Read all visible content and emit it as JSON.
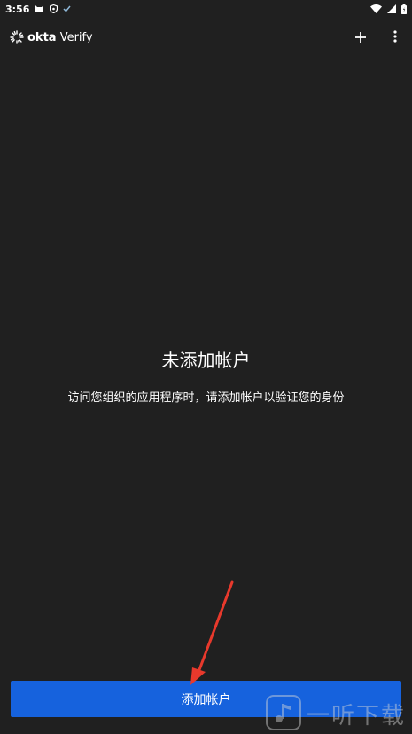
{
  "status_bar": {
    "time": "3:56",
    "left_icons": [
      "cat-icon",
      "shield-icon",
      "check-icon"
    ],
    "right_icons": [
      "wifi-icon",
      "signal-icon",
      "battery-icon"
    ]
  },
  "app_bar": {
    "logo_bold": "okta",
    "logo_rest": " Verify",
    "add_icon": "plus-icon",
    "more_icon": "more-vert-icon"
  },
  "empty_state": {
    "title": "未添加帐户",
    "description": "访问您组织的应用程序时，请添加帐户以验证您的身份"
  },
  "bottom": {
    "add_account_label": "添加帐户"
  },
  "watermark": {
    "text": "一听下载"
  },
  "colors": {
    "background": "#202020",
    "button": "#1662dd",
    "arrow": "#e8392c"
  }
}
